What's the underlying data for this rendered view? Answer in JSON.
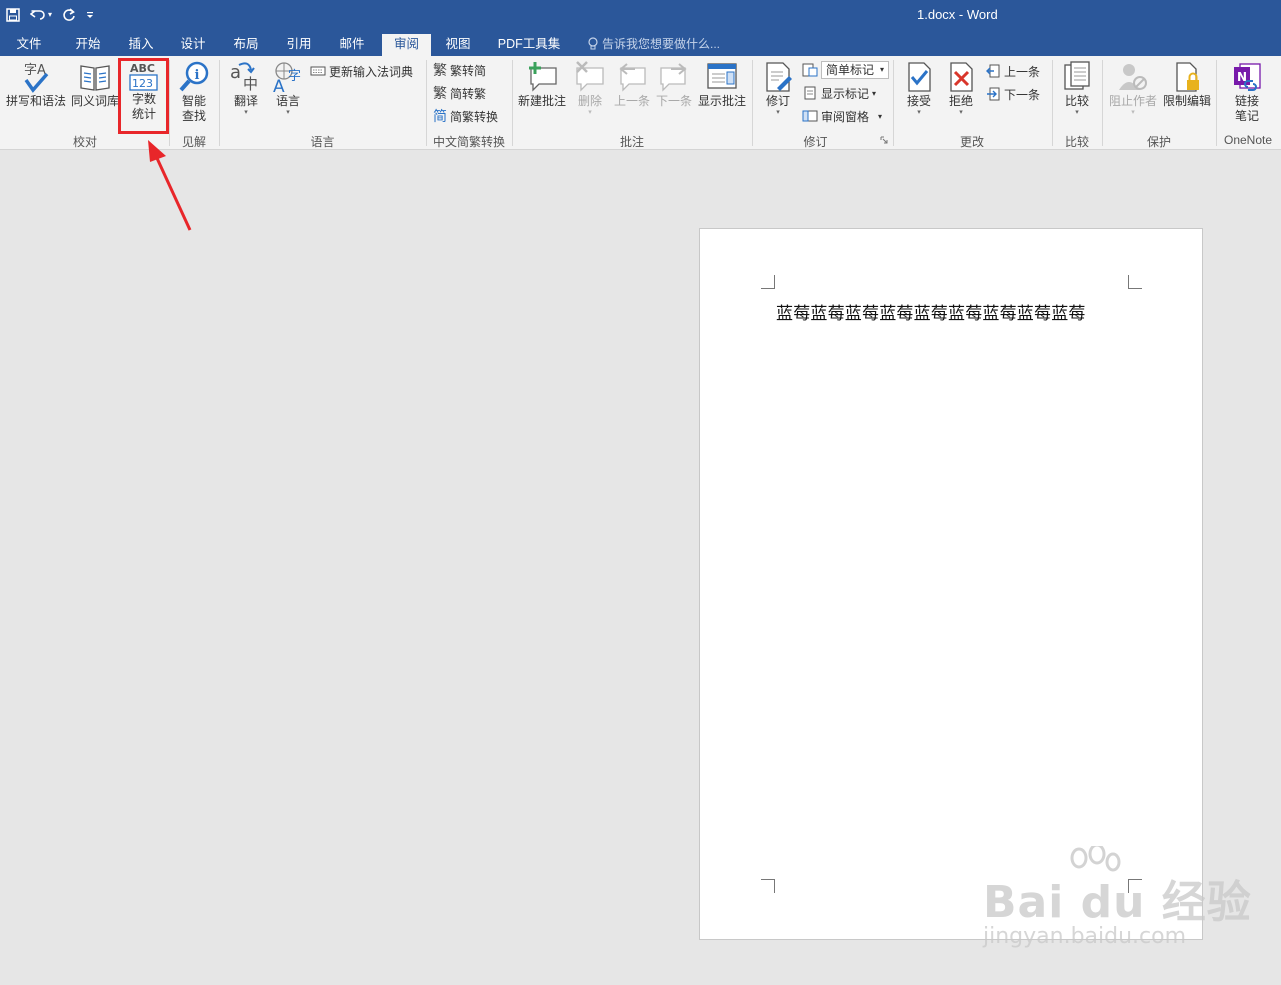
{
  "window": {
    "title": "1.docx - Word"
  },
  "qat": {
    "save_icon": "save-icon",
    "undo_icon": "undo-icon",
    "redo_icon": "redo-icon",
    "customize_icon": "customize-qat-icon"
  },
  "tabs": [
    "文件",
    "开始",
    "插入",
    "设计",
    "布局",
    "引用",
    "邮件",
    "审阅",
    "视图",
    "PDF工具集"
  ],
  "active_tab": "审阅",
  "tell_me": "告诉我您想要做什么...",
  "ribbon": {
    "proofing": {
      "label": "校对",
      "spelling": "拼写和语法",
      "thesaurus": "同义词库",
      "wordcount_line1": "字数",
      "wordcount_line2": "统计"
    },
    "insights": {
      "label": "见解",
      "smart_line1": "智能",
      "smart_line2": "查找"
    },
    "language": {
      "label": "语言",
      "translate": "翻译",
      "language": "语言",
      "update_ime": "更新输入法词典"
    },
    "chinese": {
      "label": "中文简繁转换",
      "trad_to_simp": "繁转简",
      "simp_to_trad": "简转繁",
      "convert": "简繁转换"
    },
    "comments": {
      "label": "批注",
      "new": "新建批注",
      "delete": "删除",
      "prev": "上一条",
      "next": "下一条",
      "show": "显示批注"
    },
    "tracking": {
      "label": "修订",
      "track": "修订",
      "markup_mode": "简单标记",
      "show_markup": "显示标记",
      "review_pane": "审阅窗格"
    },
    "changes": {
      "label": "更改",
      "accept": "接受",
      "reject": "拒绝",
      "prev": "上一条",
      "next": "下一条"
    },
    "compare": {
      "label": "比较",
      "compare": "比较"
    },
    "protect": {
      "label": "保护",
      "block_authors": "阻止作者",
      "restrict_editing": "限制编辑"
    },
    "onenote": {
      "label": "OneNote",
      "linked_line1": "链接",
      "linked_line2": "笔记"
    }
  },
  "document": {
    "text": "蓝莓蓝莓蓝莓蓝莓蓝莓蓝莓蓝莓蓝莓蓝莓"
  },
  "watermark": {
    "logo": "Bai du 经验",
    "url": "jingyan.baidu.com"
  },
  "colors": {
    "titlebar": "#2b579a",
    "ribbon": "#f3f3f3",
    "highlight": "#e8262a",
    "canvas": "#e6e6e6"
  }
}
